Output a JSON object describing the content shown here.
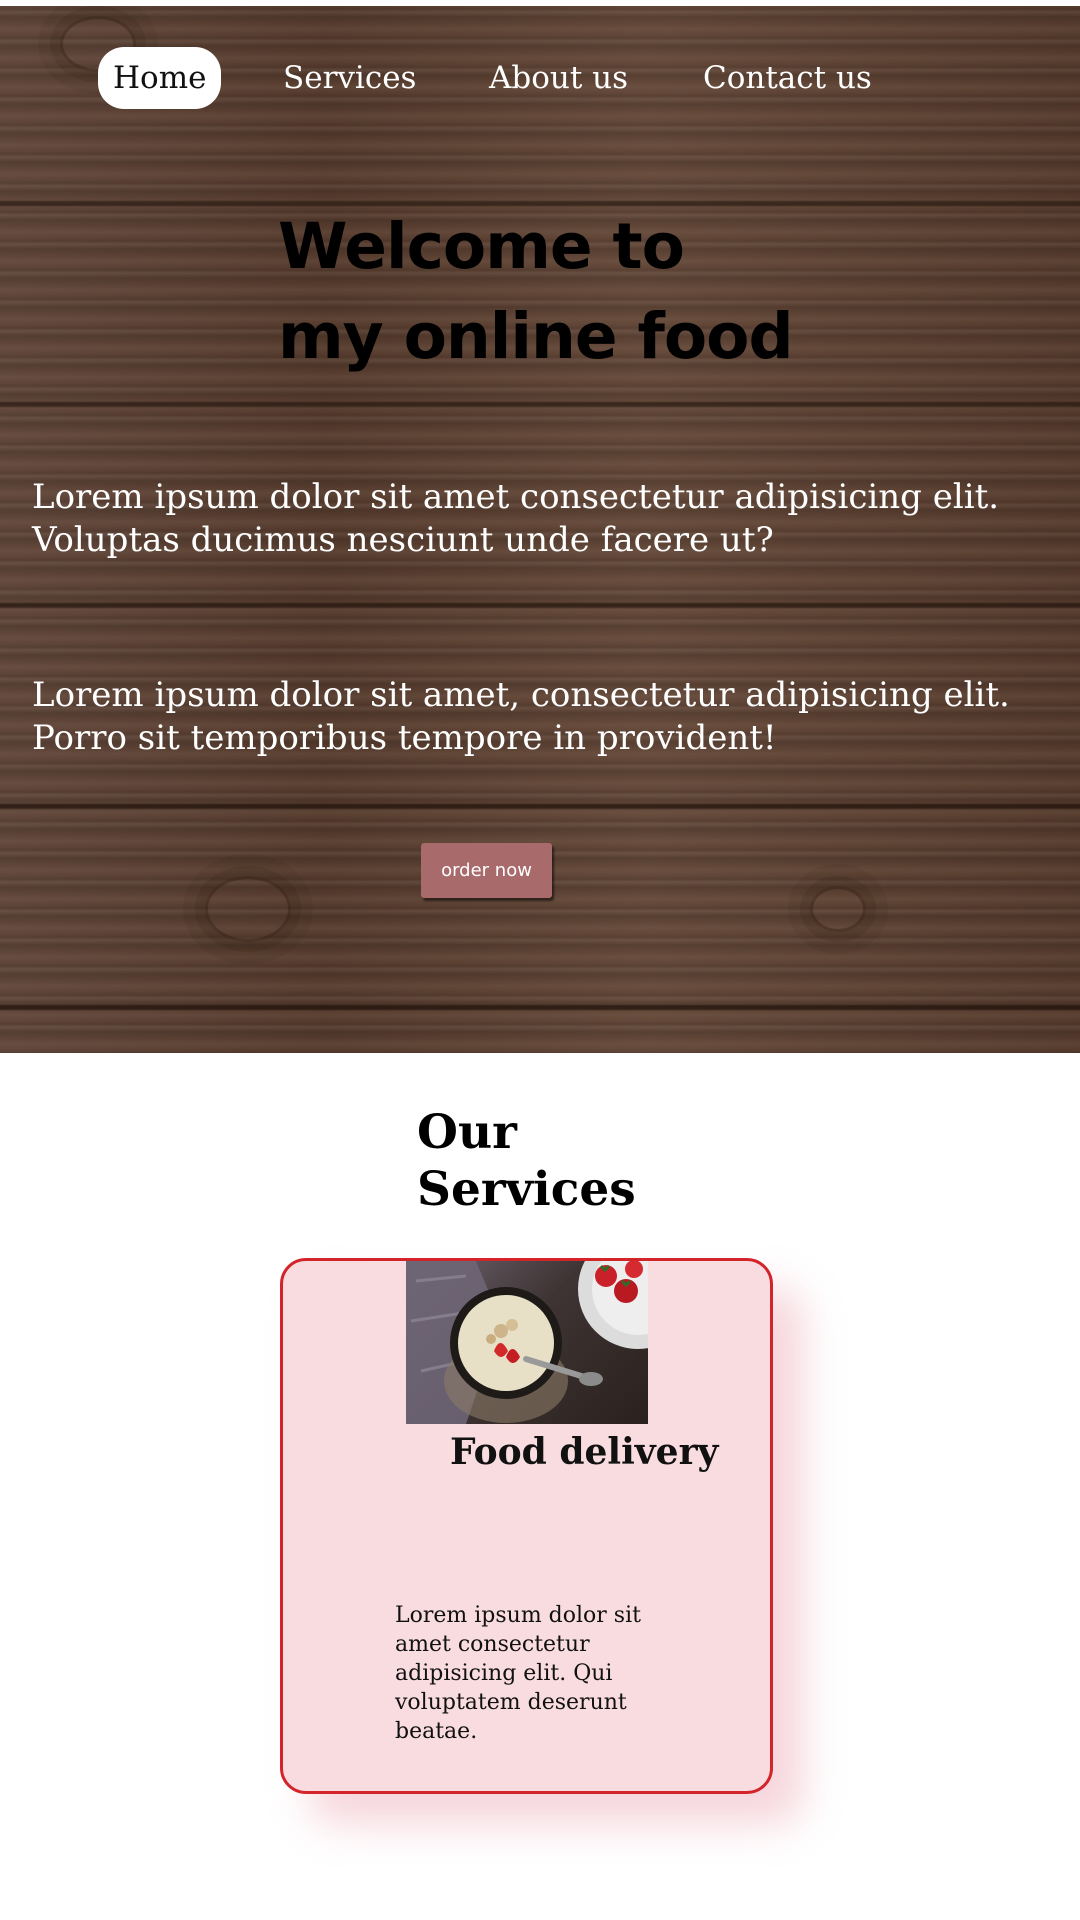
{
  "nav": {
    "items": [
      {
        "label": "Home",
        "active": true
      },
      {
        "label": "Services",
        "active": false
      },
      {
        "label": "About us",
        "active": false
      },
      {
        "label": "Contact us",
        "active": false
      }
    ]
  },
  "hero": {
    "title_lines": [
      "Welcome to",
      "my online food"
    ],
    "paragraph_1_lines": [
      "Lorem ipsum dolor sit amet consectetur adipisicing elit.",
      "Voluptas ducimus nesciunt unde facere ut?"
    ],
    "paragraph_2_lines": [
      "Lorem ipsum dolor sit amet, consectetur adipisicing elit.",
      "Porro sit temporibus tempore in provident!"
    ],
    "order_button_label": "order now"
  },
  "services": {
    "title_lines": [
      "Our",
      "Services"
    ],
    "card": {
      "title": "Food delivery",
      "text_lines": [
        "Lorem ipsum dolor sit",
        "amet consectetur",
        "adipisicing elit. Qui",
        "voluptatem deserunt",
        "beatae."
      ],
      "image_icon": "yogurt-bowl-with-strawberries-photo"
    }
  },
  "colors": {
    "accent_button": "#a86a6b",
    "card_background": "#f9dce0",
    "card_border": "#d3242a",
    "hero_wood": "#5a4030"
  }
}
